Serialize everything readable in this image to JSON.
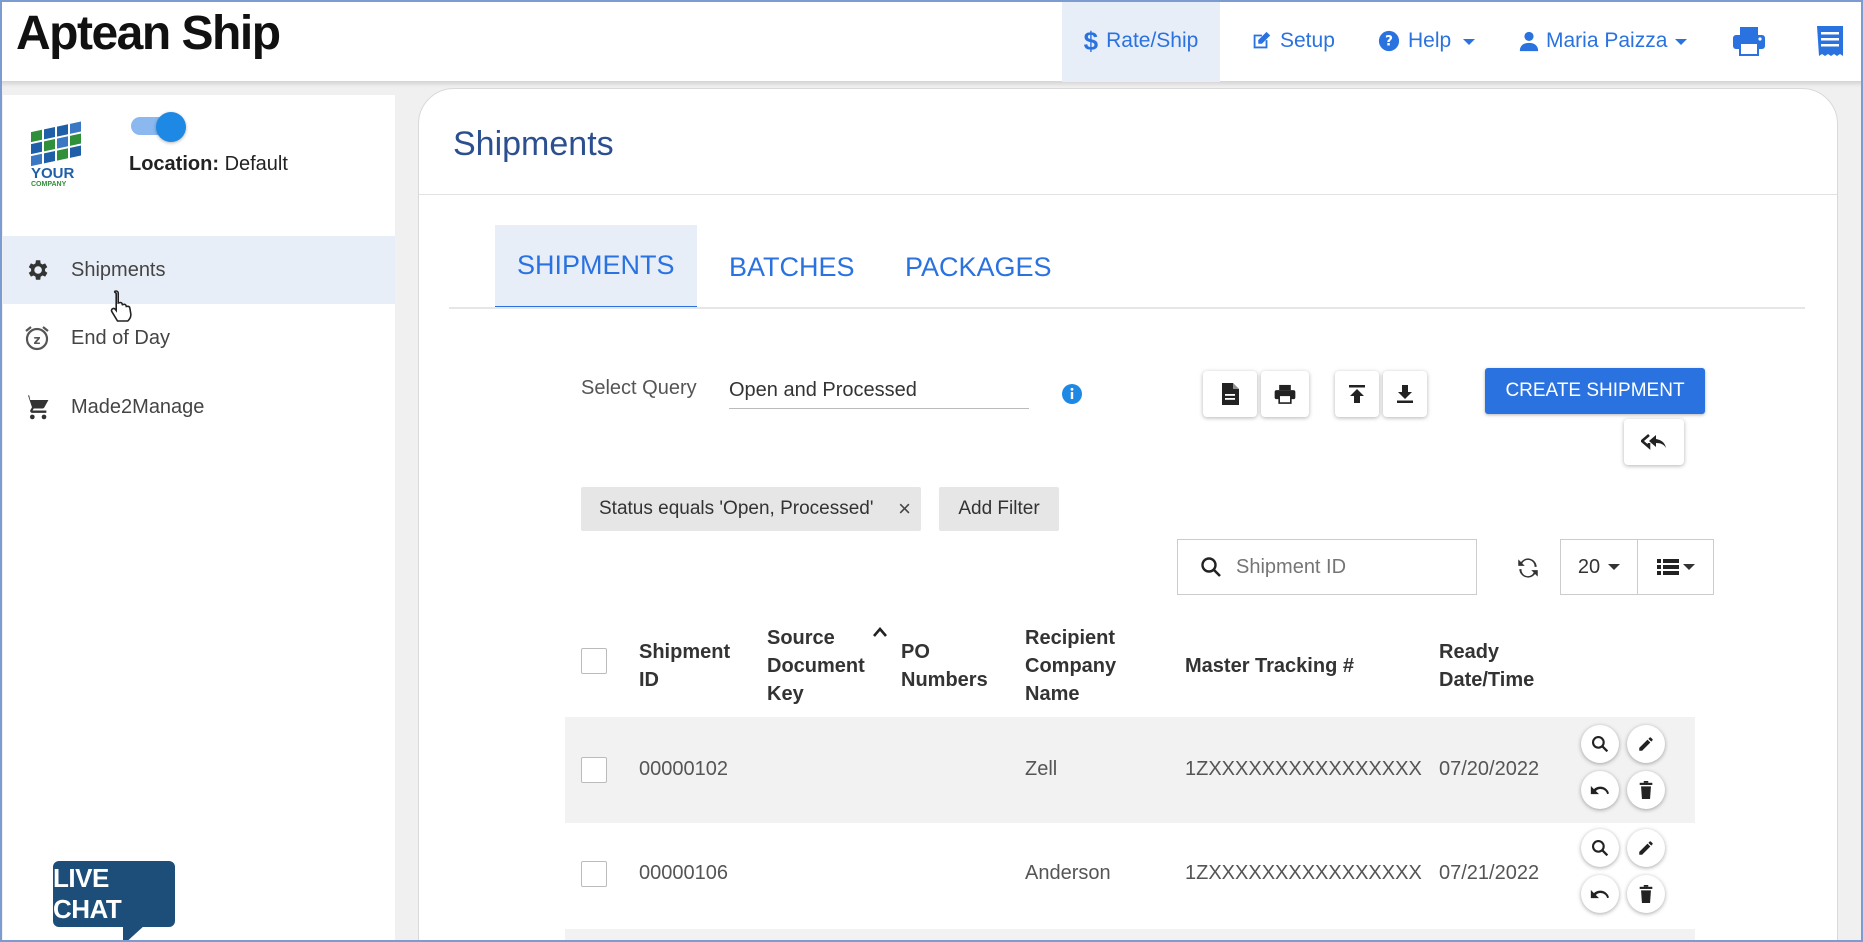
{
  "app": {
    "brand": "Aptean Ship"
  },
  "topnav": {
    "rate_ship": "Rate/Ship",
    "setup": "Setup",
    "help": "Help",
    "user": "Maria Paizza"
  },
  "sidebar": {
    "logo_text_1": "YOUR",
    "logo_text_2": "COMPANY",
    "location_label": "Location:",
    "location_value": "Default",
    "items": [
      {
        "label": "Shipments"
      },
      {
        "label": "End of Day"
      },
      {
        "label": "Made2Manage"
      }
    ],
    "live_chat": "LIVE CHAT"
  },
  "main": {
    "title": "Shipments",
    "tabs": [
      {
        "label": "SHIPMENTS"
      },
      {
        "label": "BATCHES"
      },
      {
        "label": "PACKAGES"
      }
    ],
    "query_label": "Select Query",
    "query_value": "Open and Processed",
    "create_button": "CREATE SHIPMENT",
    "filter_chip": "Status equals 'Open, Processed'",
    "filter_chip_close": "×",
    "add_filter": "Add Filter",
    "search_placeholder": "Shipment ID",
    "page_size": "20"
  },
  "table": {
    "headers": {
      "shipment_id_1": "Shipment",
      "shipment_id_2": "ID",
      "source_1": "Source",
      "source_2": "Document",
      "source_3": "Key",
      "po_1": "PO",
      "po_2": "Numbers",
      "recipient_1": "Recipient",
      "recipient_2": "Company",
      "recipient_3": "Name",
      "tracking": "Master Tracking #",
      "ready_1": "Ready",
      "ready_2": "Date/Time"
    },
    "rows": [
      {
        "id": "00000102",
        "source": "",
        "po": "",
        "recipient": "Zell",
        "tracking": "1ZXXXXXXXXXXXXXXXX",
        "ready": "07/20/2022"
      },
      {
        "id": "00000106",
        "source": "",
        "po": "",
        "recipient": "Anderson",
        "tracking": "1ZXXXXXXXXXXXXXXXX",
        "ready": "07/21/2022"
      }
    ]
  },
  "colors": {
    "accent": "#2a72e0",
    "title": "#2b4f8f",
    "live_chat": "#1d4e7a"
  }
}
